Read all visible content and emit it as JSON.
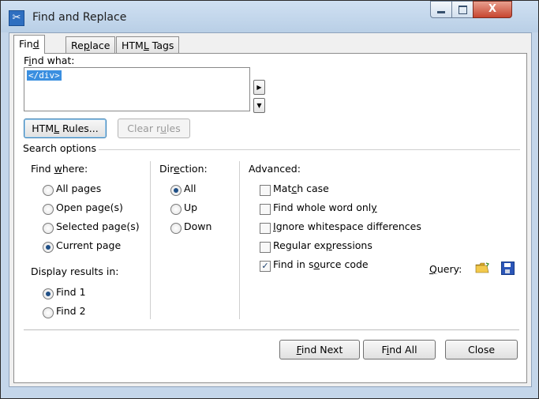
{
  "window": {
    "title": "Find and Replace",
    "icon": "scissors-icon",
    "close_glyph": "X"
  },
  "tabs": [
    {
      "label_pre": "Fin",
      "label_u": "d",
      "label_post": "",
      "active": true
    },
    {
      "label_pre": "Re",
      "label_u": "p",
      "label_post": "lace",
      "active": false
    },
    {
      "label_pre": "HTM",
      "label_u": "L",
      "label_post": " Tags",
      "active": false
    }
  ],
  "find": {
    "label_pre": "F",
    "label_u": "i",
    "label_post": "nd what:",
    "value": "</div>",
    "arrow_right": "▶",
    "arrow_down": "▼"
  },
  "buttons": {
    "html_rules_pre": "HTM",
    "html_rules_u": "L",
    "html_rules_post": " Rules...",
    "clear_rules_pre": "Clear r",
    "clear_rules_u": "u",
    "clear_rules_post": "les",
    "find_next_pre": "",
    "find_next_u": "F",
    "find_next_post": "ind Next",
    "find_all_pre": "F",
    "find_all_u": "i",
    "find_all_post": "nd All",
    "close": "Close"
  },
  "search_options": {
    "header": "Search options",
    "find_where": {
      "label_pre": "Find ",
      "label_u": "w",
      "label_post": "here:",
      "options": [
        "All pages",
        "Open page(s)",
        "Selected page(s)",
        "Current page"
      ],
      "selected": "Current page"
    },
    "display_results": {
      "label": "Display results in:",
      "options": [
        "Find 1",
        "Find 2"
      ],
      "selected": "Find 1"
    },
    "direction": {
      "label_pre": "Dir",
      "label_u": "e",
      "label_post": "ction:",
      "options": [
        "All",
        "Up",
        "Down"
      ],
      "selected": "All"
    },
    "advanced": {
      "label": "Advanced:",
      "checks": [
        {
          "pre": "Mat",
          "u": "c",
          "post": "h case",
          "checked": false
        },
        {
          "pre": "Find whole word onl",
          "u": "y",
          "post": "",
          "checked": false
        },
        {
          "pre": "",
          "u": "I",
          "post": "gnore whitespace differences",
          "checked": false
        },
        {
          "pre": "Regular ex",
          "u": "p",
          "post": "ressions",
          "checked": false
        },
        {
          "pre": "Find in s",
          "u": "o",
          "post": "urce code",
          "checked": true
        }
      ],
      "query_pre": "",
      "query_u": "Q",
      "query_post": "uery:"
    }
  }
}
